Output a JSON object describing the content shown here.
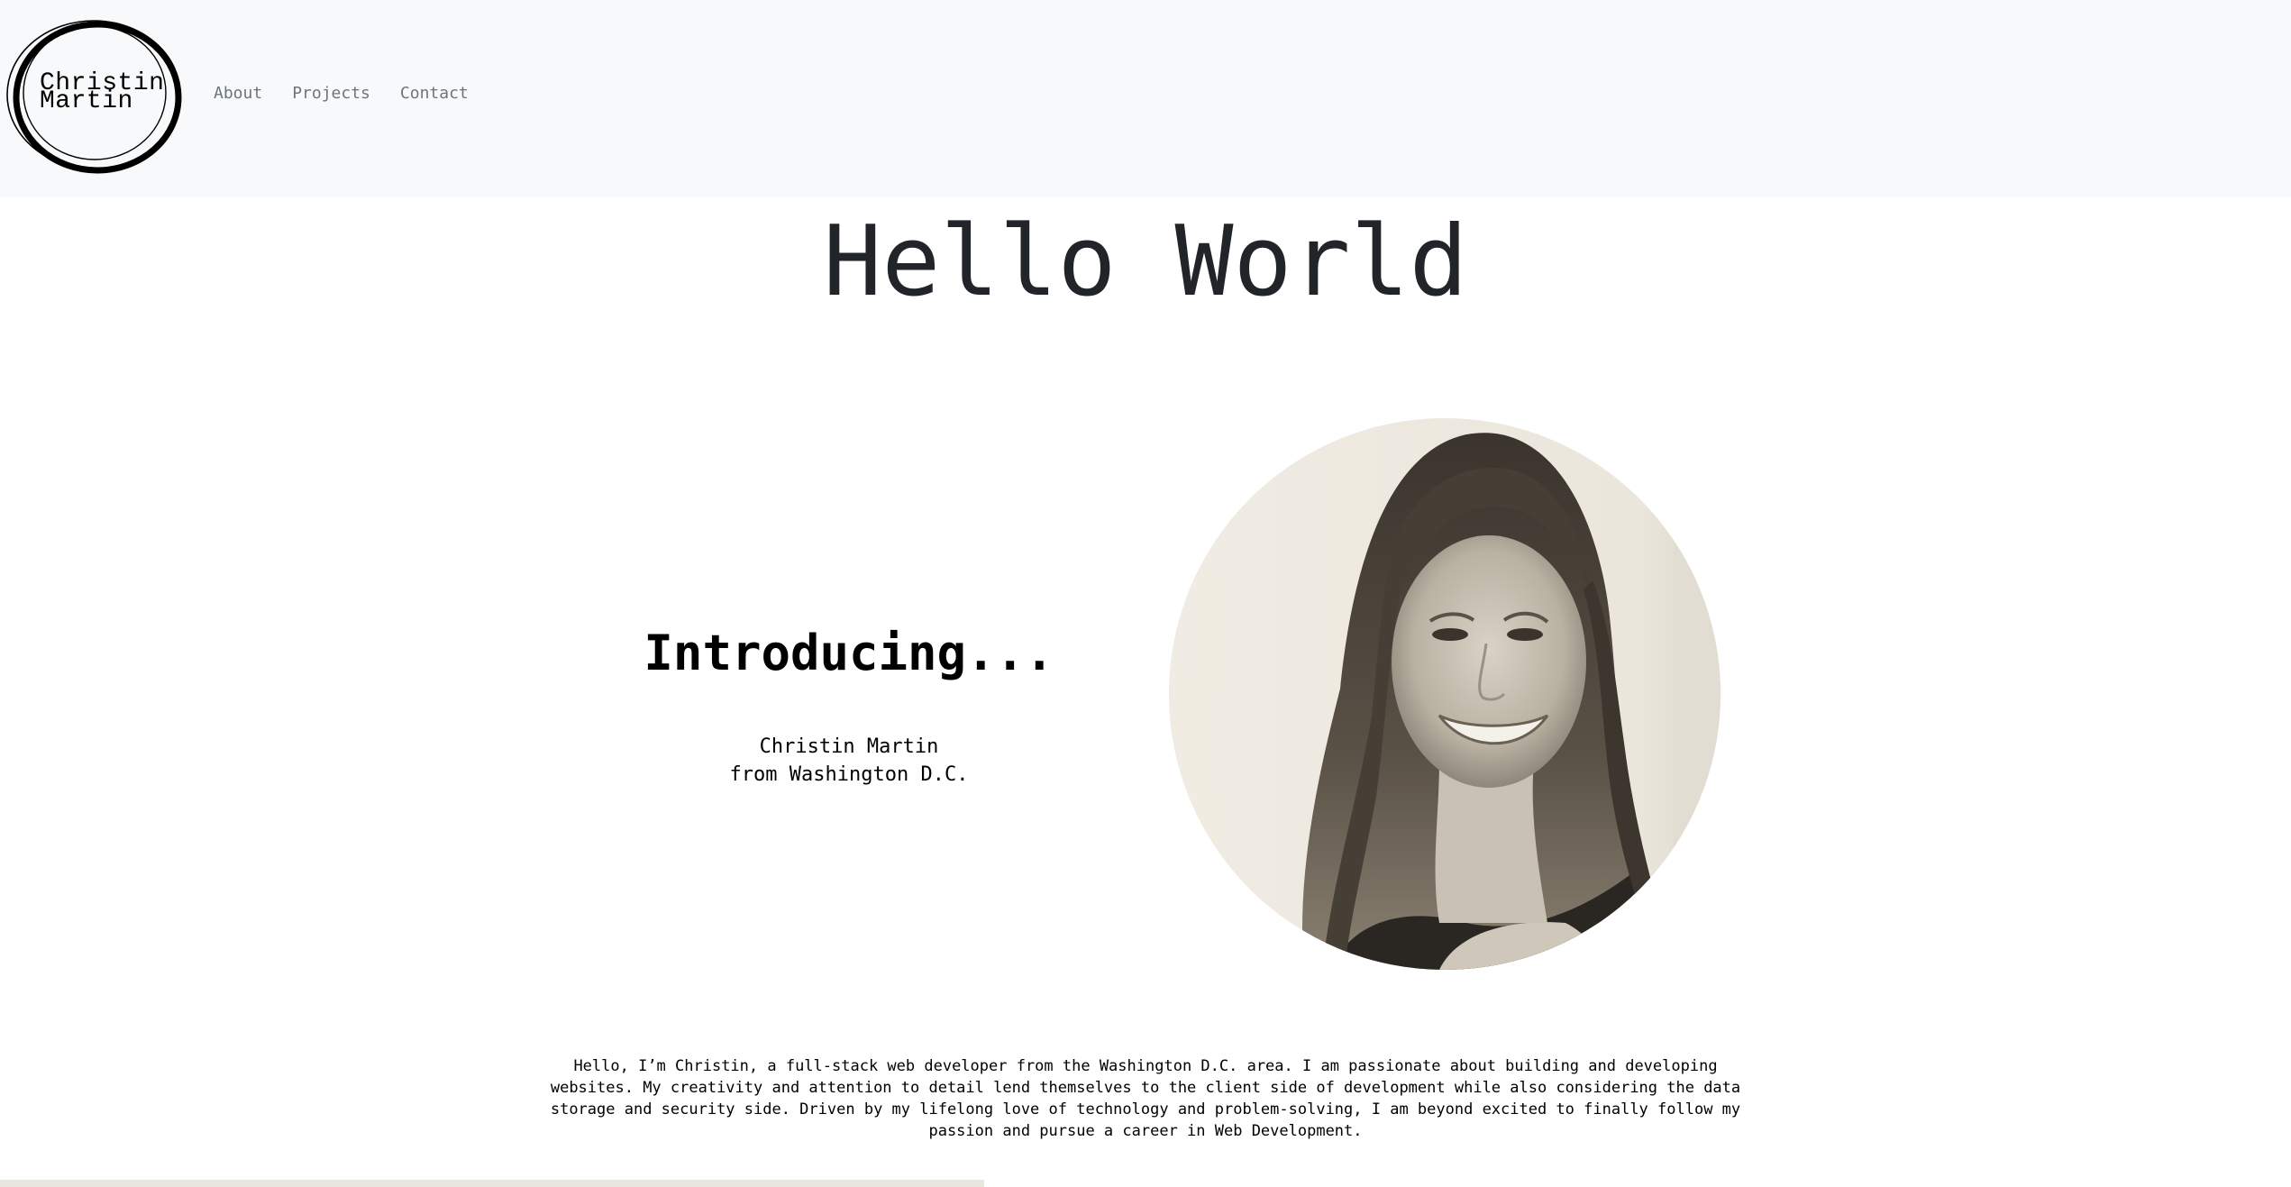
{
  "header": {
    "logo_line1": "Christin",
    "logo_line2": "Martin",
    "nav": [
      {
        "label": "About"
      },
      {
        "label": "Projects"
      },
      {
        "label": "Contact"
      }
    ]
  },
  "hero": {
    "title": "Hello World"
  },
  "intro": {
    "heading": "Introducing...",
    "name": "Christin Martin",
    "location": "from Washington D.C."
  },
  "bio": {
    "text": "Hello, I’m Christin, a full-stack web developer from the Washington D.C. area. I am passionate about building and developing websites. My creativity and attention to detail lend themselves to the client side of development while also considering the data storage and security side. Driven by my lifelong love of technology and problem-solving, I am beyond excited to finally follow my passion and pursue a career in Web Development."
  },
  "colors": {
    "navbar_bg": "#f8f9fa",
    "nav_link": "#6c757d",
    "title_text": "#212529",
    "portrait_bg": "#efebe2"
  }
}
